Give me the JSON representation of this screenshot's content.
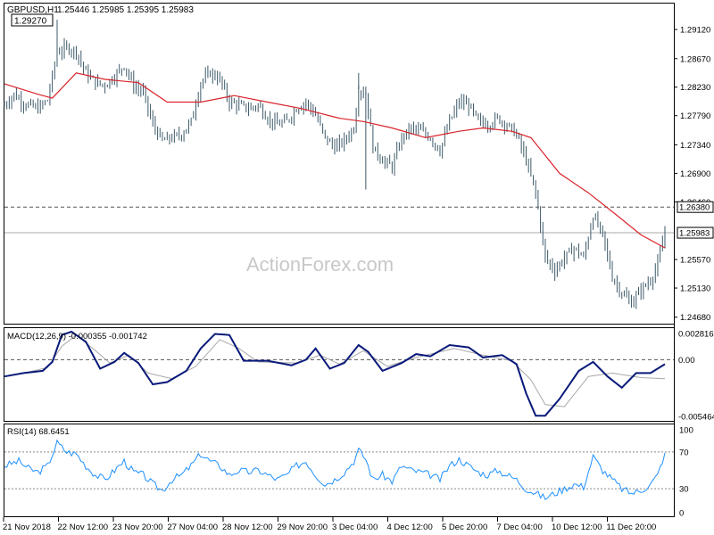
{
  "header": {
    "symbol_label": "GBPUSD,H1",
    "ohlc_text": "1.25446 1.25985 1.25395 1.25983",
    "high_marker_label": "1.29270"
  },
  "watermark": "ActionForex.com",
  "colors": {
    "price_bars": "#3d5a6a",
    "moving_average": "#d9232a",
    "macd_line": "#0a1a7a",
    "macd_signal": "#a8a8a8",
    "rsi_line": "#1e90ff",
    "frame": "#000000",
    "dashed_level": "#555555"
  },
  "chart_data": [
    {
      "type": "ohlc",
      "name": "price",
      "title": "GBPUSD,H1",
      "y_ticks": [
        "1.29120",
        "1.28670",
        "1.28230",
        "1.27790",
        "1.27340",
        "1.26900",
        "1.26460",
        "1.25570",
        "1.25130",
        "1.24680"
      ],
      "ylim": [
        1.2458,
        1.2952
      ],
      "x_ticks": [
        "21 Nov 2018",
        "22 Nov 12:00",
        "23 Nov 20:00",
        "27 Nov 04:00",
        "28 Nov 12:00",
        "29 Nov 20:00",
        "3 Dec 04:00",
        "4 Dec 12:00",
        "5 Dec 20:00",
        "7 Dec 04:00",
        "10 Dec 12:00",
        "11 Dec 20:00"
      ],
      "last": {
        "open": 1.25446,
        "high": 1.25985,
        "low": 1.25395,
        "close": 1.25983
      },
      "horizontal_lines": [
        {
          "value": 1.2638,
          "label": "1.26380",
          "style": "dashed"
        },
        {
          "value": 1.25983,
          "label": "1.25983",
          "style": "solid"
        }
      ],
      "high_marker": 1.2927,
      "close_path": [
        [
          0,
          1.2795
        ],
        [
          4,
          1.2812
        ],
        [
          8,
          1.2798
        ],
        [
          14,
          1.279
        ],
        [
          18,
          1.2803
        ],
        [
          22,
          1.2876
        ],
        [
          26,
          1.2884
        ],
        [
          30,
          1.2878
        ],
        [
          34,
          1.2845
        ],
        [
          38,
          1.283
        ],
        [
          42,
          1.2826
        ],
        [
          46,
          1.284
        ],
        [
          50,
          1.2857
        ],
        [
          54,
          1.2825
        ],
        [
          58,
          1.2815
        ],
        [
          62,
          1.2765
        ],
        [
          66,
          1.274
        ],
        [
          70,
          1.2745
        ],
        [
          74,
          1.275
        ],
        [
          78,
          1.277
        ],
        [
          82,
          1.283
        ],
        [
          86,
          1.2845
        ],
        [
          90,
          1.2835
        ],
        [
          94,
          1.28
        ],
        [
          98,
          1.2795
        ],
        [
          102,
          1.279
        ],
        [
          106,
          1.2795
        ],
        [
          110,
          1.2775
        ],
        [
          114,
          1.2765
        ],
        [
          118,
          1.277
        ],
        [
          122,
          1.279
        ],
        [
          126,
          1.28
        ],
        [
          130,
          1.278
        ],
        [
          134,
          1.2745
        ],
        [
          138,
          1.273
        ],
        [
          142,
          1.274
        ],
        [
          146,
          1.276
        ],
        [
          148,
          1.282
        ],
        [
          151,
          1.2815
        ],
        [
          154,
          1.273
        ],
        [
          158,
          1.271
        ],
        [
          162,
          1.27
        ],
        [
          166,
          1.2745
        ],
        [
          170,
          1.276
        ],
        [
          174,
          1.2755
        ],
        [
          178,
          1.2745
        ],
        [
          182,
          1.2725
        ],
        [
          186,
          1.277
        ],
        [
          190,
          1.28
        ],
        [
          194,
          1.2795
        ],
        [
          198,
          1.277
        ],
        [
          202,
          1.2765
        ],
        [
          206,
          1.2775
        ],
        [
          210,
          1.2765
        ],
        [
          214,
          1.275
        ],
        [
          218,
          1.271
        ],
        [
          222,
          1.266
        ],
        [
          226,
          1.256
        ],
        [
          230,
          1.254
        ],
        [
          234,
          1.256
        ],
        [
          238,
          1.2575
        ],
        [
          242,
          1.256
        ],
        [
          246,
          1.2625
        ],
        [
          250,
          1.2595
        ],
        [
          254,
          1.253
        ],
        [
          258,
          1.2505
        ],
        [
          262,
          1.249
        ],
        [
          266,
          1.251
        ],
        [
          270,
          1.2525
        ],
        [
          273,
          1.255
        ],
        [
          276,
          1.2598
        ]
      ],
      "moving_average": [
        [
          0,
          1.2828
        ],
        [
          14,
          1.2812
        ],
        [
          20,
          1.2806
        ],
        [
          30,
          1.2845
        ],
        [
          42,
          1.2835
        ],
        [
          56,
          1.283
        ],
        [
          68,
          1.28
        ],
        [
          82,
          1.28
        ],
        [
          96,
          1.281
        ],
        [
          110,
          1.28
        ],
        [
          124,
          1.279
        ],
        [
          140,
          1.2775
        ],
        [
          150,
          1.277
        ],
        [
          162,
          1.276
        ],
        [
          176,
          1.2745
        ],
        [
          190,
          1.2755
        ],
        [
          200,
          1.276
        ],
        [
          212,
          1.2755
        ],
        [
          220,
          1.2745
        ],
        [
          232,
          1.269
        ],
        [
          244,
          1.266
        ],
        [
          256,
          1.2625
        ],
        [
          266,
          1.2595
        ],
        [
          276,
          1.2575
        ]
      ]
    },
    {
      "type": "line",
      "name": "macd",
      "label": "MACD(12,26,9) -0.000355 -0.001742",
      "y_ticks": [
        "0.002816",
        "0.00",
        "-0.005464"
      ],
      "ylim": [
        -0.005464,
        0.002816
      ],
      "dashed_level": 0.0,
      "macd_path": [
        [
          0,
          -0.0015
        ],
        [
          8,
          -0.0012
        ],
        [
          16,
          -0.001
        ],
        [
          20,
          -0.0002
        ],
        [
          24,
          0.0022
        ],
        [
          28,
          0.0025
        ],
        [
          34,
          0.0016
        ],
        [
          40,
          -0.0008
        ],
        [
          46,
          -0.0002
        ],
        [
          50,
          0.0006
        ],
        [
          56,
          -0.0003
        ],
        [
          62,
          -0.0022
        ],
        [
          68,
          -0.002
        ],
        [
          76,
          -0.001
        ],
        [
          82,
          0.001
        ],
        [
          88,
          0.0023
        ],
        [
          94,
          0.0022
        ],
        [
          100,
          -0.0001
        ],
        [
          110,
          -0.0001
        ],
        [
          120,
          -0.0005
        ],
        [
          126,
          0.0
        ],
        [
          130,
          0.001
        ],
        [
          136,
          -0.0008
        ],
        [
          142,
          -0.0003
        ],
        [
          148,
          0.0013
        ],
        [
          152,
          0.0007
        ],
        [
          158,
          -0.001
        ],
        [
          166,
          -0.0003
        ],
        [
          172,
          0.0005
        ],
        [
          178,
          0.0003
        ],
        [
          186,
          0.0013
        ],
        [
          194,
          0.0011
        ],
        [
          200,
          0.0002
        ],
        [
          208,
          0.0004
        ],
        [
          214,
          -0.0004
        ],
        [
          218,
          -0.003
        ],
        [
          222,
          -0.005
        ],
        [
          226,
          -0.005
        ],
        [
          232,
          -0.0035
        ],
        [
          240,
          -0.001
        ],
        [
          246,
          -0.0002
        ],
        [
          252,
          -0.0015
        ],
        [
          258,
          -0.0025
        ],
        [
          264,
          -0.0012
        ],
        [
          270,
          -0.0012
        ],
        [
          276,
          -0.0004
        ]
      ],
      "signal_path": [
        [
          0,
          -0.0015
        ],
        [
          10,
          -0.0011
        ],
        [
          18,
          -0.0007
        ],
        [
          24,
          0.0012
        ],
        [
          30,
          0.0022
        ],
        [
          38,
          0.0008
        ],
        [
          44,
          -0.0003
        ],
        [
          52,
          0.0004
        ],
        [
          60,
          -0.0012
        ],
        [
          70,
          -0.0017
        ],
        [
          80,
          -0.0006
        ],
        [
          90,
          0.0018
        ],
        [
          98,
          0.001
        ],
        [
          106,
          -0.0002
        ],
        [
          122,
          -0.0003
        ],
        [
          132,
          0.0004
        ],
        [
          140,
          -0.0004
        ],
        [
          150,
          0.0008
        ],
        [
          160,
          -0.0006
        ],
        [
          172,
          0.0002
        ],
        [
          188,
          0.001
        ],
        [
          200,
          0.0004
        ],
        [
          212,
          -0.0001
        ],
        [
          220,
          -0.0018
        ],
        [
          226,
          -0.004
        ],
        [
          234,
          -0.0042
        ],
        [
          244,
          -0.0015
        ],
        [
          254,
          -0.0012
        ],
        [
          266,
          -0.0016
        ],
        [
          276,
          -0.0017
        ]
      ]
    },
    {
      "type": "line",
      "name": "rsi",
      "label": "RSI(14) 68.6451",
      "y_ticks": [
        "100",
        "70",
        "30",
        "0"
      ],
      "ylim": [
        0,
        100
      ],
      "levels": [
        70,
        30
      ],
      "rsi_path": [
        [
          0,
          55
        ],
        [
          6,
          60
        ],
        [
          10,
          52
        ],
        [
          14,
          48
        ],
        [
          18,
          55
        ],
        [
          22,
          80
        ],
        [
          26,
          70
        ],
        [
          30,
          68
        ],
        [
          34,
          55
        ],
        [
          38,
          45
        ],
        [
          42,
          40
        ],
        [
          46,
          50
        ],
        [
          50,
          60
        ],
        [
          54,
          48
        ],
        [
          58,
          45
        ],
        [
          62,
          35
        ],
        [
          66,
          28
        ],
        [
          70,
          40
        ],
        [
          74,
          45
        ],
        [
          78,
          55
        ],
        [
          82,
          68
        ],
        [
          86,
          60
        ],
        [
          90,
          55
        ],
        [
          94,
          45
        ],
        [
          98,
          50
        ],
        [
          102,
          48
        ],
        [
          106,
          50
        ],
        [
          110,
          45
        ],
        [
          114,
          40
        ],
        [
          118,
          45
        ],
        [
          122,
          55
        ],
        [
          126,
          60
        ],
        [
          130,
          45
        ],
        [
          134,
          35
        ],
        [
          138,
          40
        ],
        [
          142,
          48
        ],
        [
          146,
          60
        ],
        [
          148,
          72
        ],
        [
          151,
          62
        ],
        [
          154,
          40
        ],
        [
          158,
          45
        ],
        [
          162,
          38
        ],
        [
          166,
          55
        ],
        [
          170,
          50
        ],
        [
          174,
          48
        ],
        [
          178,
          45
        ],
        [
          182,
          40
        ],
        [
          186,
          55
        ],
        [
          190,
          62
        ],
        [
          194,
          55
        ],
        [
          198,
          48
        ],
        [
          202,
          45
        ],
        [
          206,
          50
        ],
        [
          210,
          45
        ],
        [
          214,
          40
        ],
        [
          218,
          30
        ],
        [
          222,
          25
        ],
        [
          226,
          20
        ],
        [
          230,
          25
        ],
        [
          234,
          30
        ],
        [
          238,
          35
        ],
        [
          242,
          32
        ],
        [
          246,
          65
        ],
        [
          250,
          50
        ],
        [
          254,
          40
        ],
        [
          258,
          30
        ],
        [
          262,
          25
        ],
        [
          266,
          28
        ],
        [
          270,
          35
        ],
        [
          273,
          45
        ],
        [
          276,
          69
        ]
      ]
    }
  ]
}
